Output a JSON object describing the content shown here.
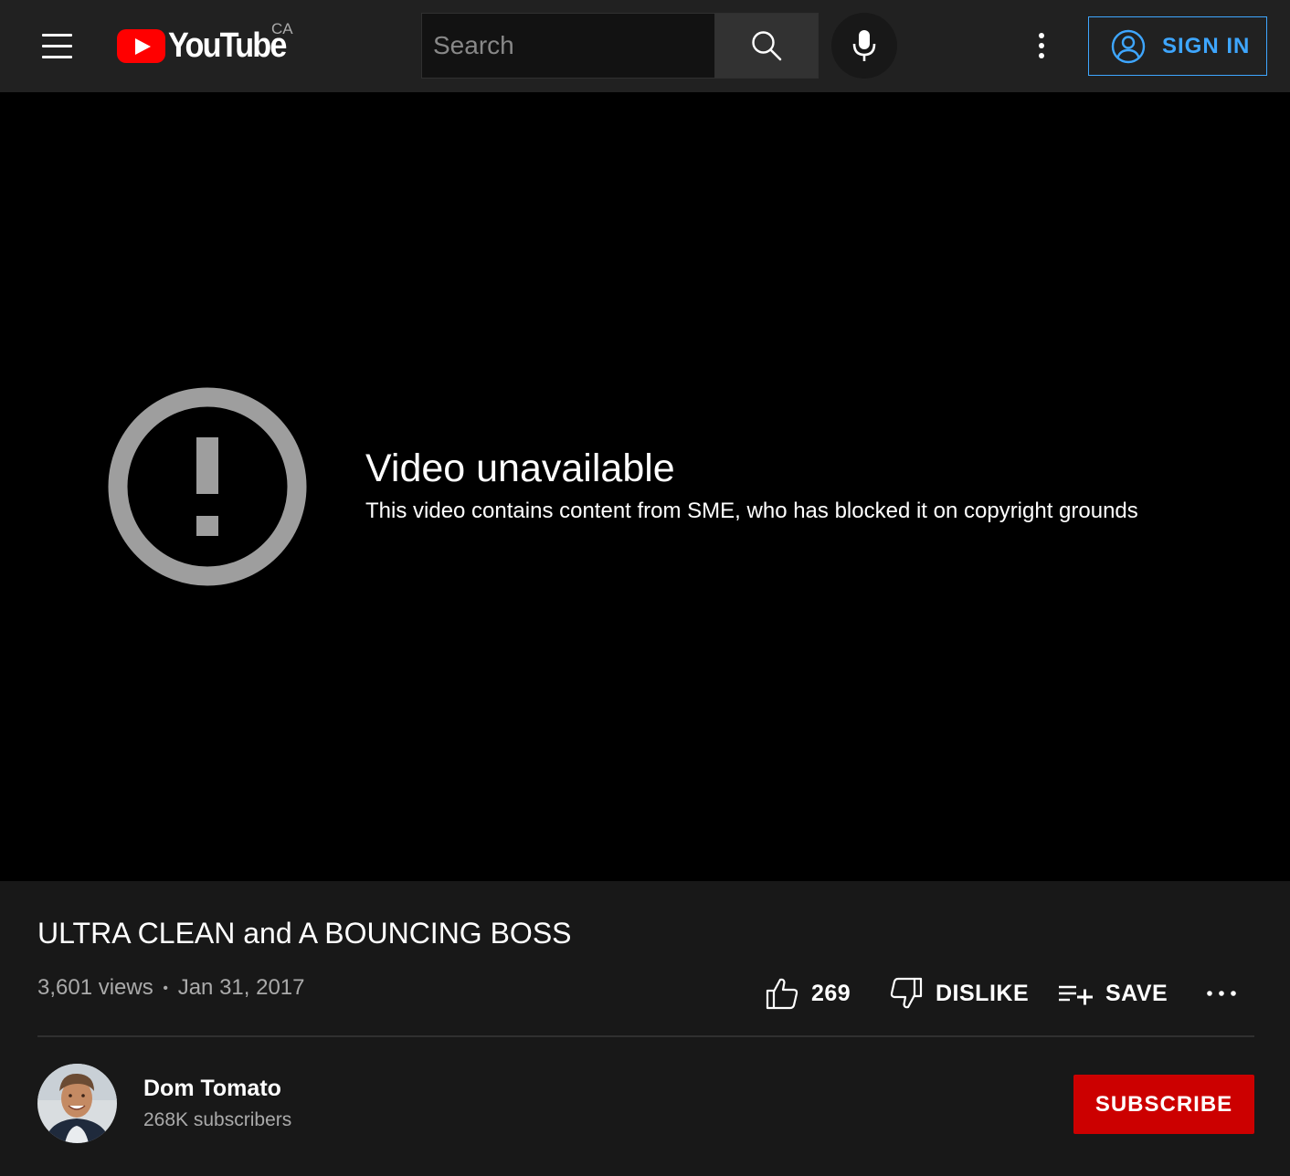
{
  "header": {
    "logo_text": "YouTube",
    "country_code": "CA",
    "search_placeholder": "Search",
    "search_value": "",
    "sign_in_label": "SIGN IN"
  },
  "player": {
    "error_title": "Video unavailable",
    "error_reason": "This video contains content from SME, who has blocked it on copyright grounds"
  },
  "video": {
    "title": "ULTRA CLEAN and A BOUNCING BOSS",
    "views": "3,601 views",
    "separator": "•",
    "date": "Jan 31, 2017",
    "like_count": "269",
    "dislike_label": "DISLIKE",
    "save_label": "SAVE"
  },
  "channel": {
    "name": "Dom Tomato",
    "subscribers": "268K subscribers",
    "subscribe_label": "SUBSCRIBE"
  },
  "icons": {
    "menu": "hamburger-menu-icon",
    "search": "search-icon",
    "mic": "microphone-icon",
    "more": "vertical-dots-icon",
    "account": "account-circle-icon",
    "error": "exclamation-circle-icon",
    "like": "thumbs-up-icon",
    "dislike": "thumbs-down-icon",
    "save": "playlist-add-icon",
    "actions_more": "horizontal-dots-icon"
  },
  "colors": {
    "accent_blue": "#3ea6ff",
    "brand_red": "#ff0000",
    "subscribe_red": "#cc0000",
    "topbar_bg": "#212121",
    "page_bg": "#181818"
  }
}
